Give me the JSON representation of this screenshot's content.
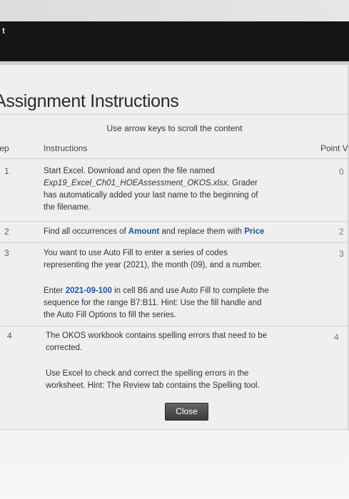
{
  "header": {
    "partial_char": "t"
  },
  "dialog": {
    "title": "Assignment Instructions",
    "scroll_hint": "Use arrow keys to scroll the content",
    "columns": {
      "step": "tep",
      "instructions": "Instructions",
      "points": "Point V"
    },
    "rows": [
      {
        "step": "1",
        "points": "0",
        "lines": [
          "Start Excel. Download and open the file named",
          "Exp19_Excel_Ch01_HOEAssessment_OKOS.xlsx.",
          "Grader",
          "has automatically added your last name to the beginning of",
          "the filename."
        ]
      },
      {
        "step": "2",
        "points": "2",
        "pre": "Find all occurrences of ",
        "hl1": "Amount",
        "mid": " and replace them with ",
        "hl2": "Price"
      },
      {
        "step": "3",
        "points": "3",
        "lines": [
          "You want to use Auto Fill to enter a series of codes",
          "representing the year (2021), the month (09), and a number."
        ],
        "pre2": "Enter ",
        "hl": "2021-09-100",
        "post2": " in cell B6 and use Auto Fill to complete the",
        "lines2": [
          "sequence for the range B7:B11. Hint: Use the fill handle and",
          "the Auto Fill Options to fill the series."
        ]
      },
      {
        "step": "4",
        "points": "4",
        "lines": [
          "The OKOS workbook contains spelling errors that need to be",
          "corrected.",
          "Use Excel to check and correct the spelling errors in the",
          "worksheet. Hint: The Review tab contains the Spelling tool."
        ]
      }
    ],
    "close_label": "Close"
  }
}
